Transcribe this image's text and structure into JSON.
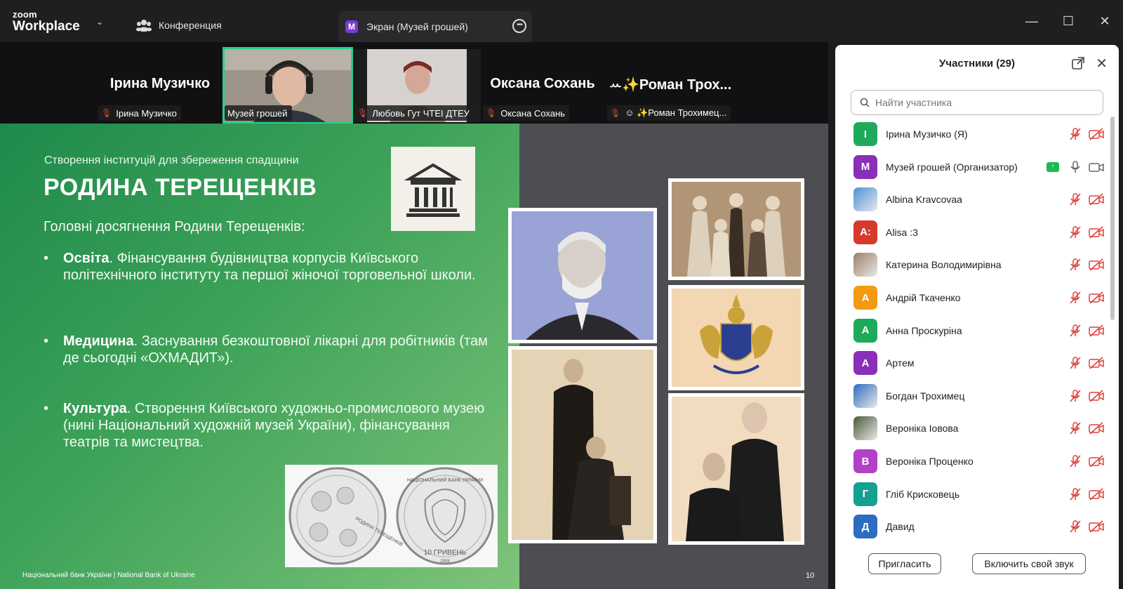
{
  "app": {
    "logo_small": "zoom",
    "logo_big": "Workplace"
  },
  "tabs": {
    "conference": "Конференция",
    "screen_badge": "M",
    "screen": "Экран (Музей грошей)"
  },
  "video_strip": [
    {
      "name_big": "Ірина Музичко",
      "label": "Ірина Музичко",
      "muted": true,
      "video": false
    },
    {
      "name_big": "",
      "label": "Музей грошей",
      "muted": false,
      "video": true,
      "active": true
    },
    {
      "name_big": "",
      "label": "Любовь Гут ЧТЕІ ДТЕУ",
      "muted": true,
      "video": true
    },
    {
      "name_big": "Оксана Сохань",
      "label": "Оксана Сохань",
      "muted": true,
      "video": false
    },
    {
      "name_big": "ꕀ✨Роман Трох...",
      "label": "☺ ✨Роман Трохимец...",
      "muted": true,
      "video": false
    }
  ],
  "slide": {
    "subtitle": "Створення інституцій для збереження спадщини",
    "title": "РОДИНА ТЕРЕЩЕНКІВ",
    "lead": "Головні досягнення Родини Терещенків:",
    "bullets": [
      {
        "head": "Освіта",
        "text": ". Фінансування будівництва корпусів Київського політехнічного інституту та першої жіночої торговельної школи."
      },
      {
        "head": "Медицина",
        "text": ". Заснування безкоштовної лікарні для робітників (там де сьогодні «ОХМАДИТ»)."
      },
      {
        "head": "Культура",
        "text": ". Створення Київського художньо-промислового музею (нині Національний художній музей України), фінансування театрів та мистецтва."
      }
    ],
    "footer": "Національний банк України | National Bank of Ukraine",
    "page": "10",
    "coin_left_text": "РОДИНА ТЕРЕЩЕНКІВ",
    "coin_right_top": "НАЦІОНАЛЬНИЙ БАНК УКРАЇНИ",
    "coin_right_value": "10 ГРИВЕНЬ",
    "coin_right_year": "2008"
  },
  "participants": {
    "title": "Участники (29)",
    "search_placeholder": "Найти участника",
    "invite": "Пригласить",
    "unmute": "Включить свой звук",
    "list": [
      {
        "initial": "І",
        "name": "Ірина Музичко (Я)",
        "color": "#1eaa5a",
        "muted": true
      },
      {
        "initial": "М",
        "name": "Музей грошей (Организатор)",
        "color": "#8a2fb8",
        "muted": false,
        "sharing": true
      },
      {
        "initial": "",
        "name": "Albina Kravcovaa",
        "color": "#4a90d9",
        "muted": true,
        "image": true
      },
      {
        "initial": "A:",
        "name": "Alisa :3",
        "color": "#d63a2a",
        "muted": true
      },
      {
        "initial": "",
        "name": "Катерина Володимирівна",
        "color": "#9a7f6a",
        "muted": true,
        "image": true
      },
      {
        "initial": "А",
        "name": "Андрій  Ткаченко",
        "color": "#f29a12",
        "muted": true
      },
      {
        "initial": "А",
        "name": "Анна Проскуріна",
        "color": "#1eaa5a",
        "muted": true
      },
      {
        "initial": "А",
        "name": "Артем",
        "color": "#8a2fb8",
        "muted": true
      },
      {
        "initial": "",
        "name": "Богдан Трохимец",
        "color": "#2d6cc0",
        "muted": true,
        "image": true
      },
      {
        "initial": "",
        "name": "Вероніка Іовова",
        "color": "#4a5a3a",
        "muted": true,
        "image": true
      },
      {
        "initial": "В",
        "name": "Вероніка Проценко",
        "color": "#b340c7",
        "muted": true
      },
      {
        "initial": "Г",
        "name": "Гліб Крисковець",
        "color": "#15a091",
        "muted": true
      },
      {
        "initial": "Д",
        "name": "Давид",
        "color": "#2d6cc0",
        "muted": true
      }
    ]
  }
}
